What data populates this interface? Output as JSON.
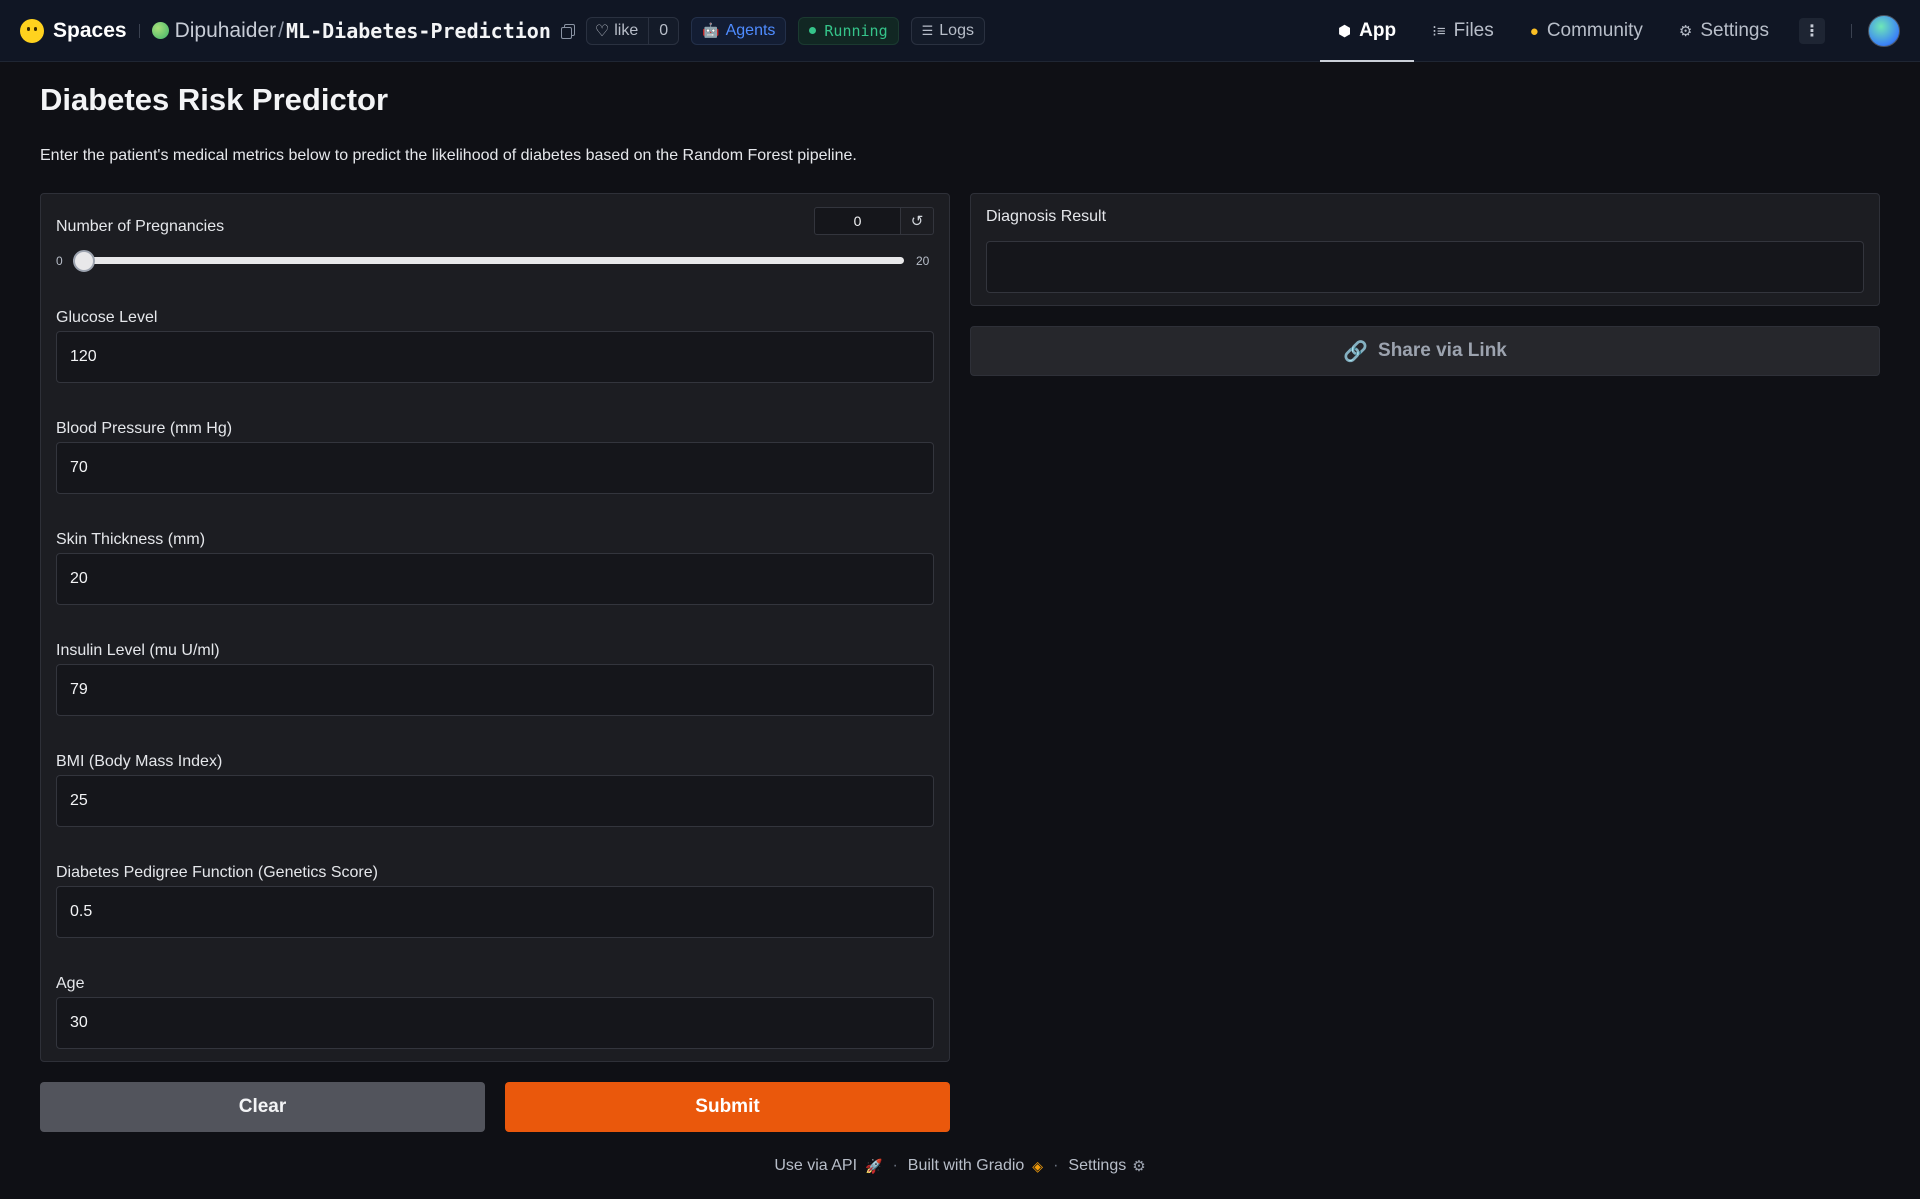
{
  "header": {
    "brand": "Spaces",
    "owner": "Dipuhaider",
    "slash": "/",
    "repo": "ML-Diabetes-Prediction",
    "like_label": "like",
    "like_count": "0",
    "agents_label": "Agents",
    "status_label": "Running",
    "logs_label": "Logs",
    "nav": {
      "app": "App",
      "files": "Files",
      "community": "Community",
      "settings": "Settings"
    }
  },
  "page": {
    "title": "Diabetes Risk Predictor",
    "description": "Enter the patient's medical metrics below to predict the likelihood of diabetes based on the Random Forest pipeline."
  },
  "inputs": {
    "pregnancies": {
      "label": "Number of Pregnancies",
      "value": "0",
      "min": "0",
      "max": "20",
      "fraction": 0
    },
    "glucose": {
      "label": "Glucose Level",
      "value": "120"
    },
    "blood_pressure": {
      "label": "Blood Pressure (mm Hg)",
      "value": "70"
    },
    "skin_thickness": {
      "label": "Skin Thickness (mm)",
      "value": "20"
    },
    "insulin": {
      "label": "Insulin Level (mu U/ml)",
      "value": "79"
    },
    "bmi": {
      "label": "BMI (Body Mass Index)",
      "value": "25"
    },
    "pedigree": {
      "label": "Diabetes Pedigree Function (Genetics Score)",
      "value": "0.5"
    },
    "age": {
      "label": "Age",
      "value": "30"
    }
  },
  "output": {
    "label": "Diagnosis Result",
    "value": "",
    "share_label": "Share via Link"
  },
  "buttons": {
    "clear": "Clear",
    "submit": "Submit"
  },
  "footer": {
    "api": "Use via API",
    "built": "Built with Gradio",
    "settings": "Settings",
    "separator": "·"
  },
  "colors": {
    "submit": "#ea580c",
    "clear": "#52545c",
    "running": "#35c48a",
    "agents": "#4f8cff"
  },
  "icons": {
    "like": "heart-icon",
    "agents": "robot-icon",
    "logs": "logs-icon",
    "app": "cube-icon",
    "files": "files-icon",
    "community": "hug-icon",
    "settings": "gear-icon",
    "share": "link-icon",
    "reset": "reset-icon"
  }
}
